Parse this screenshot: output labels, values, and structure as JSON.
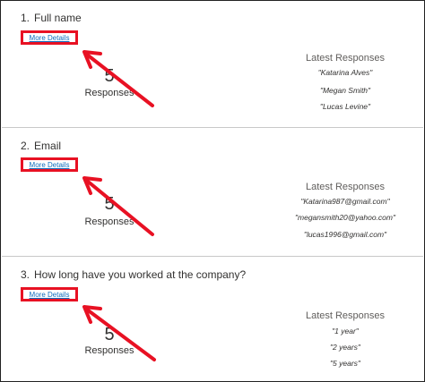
{
  "questions": [
    {
      "number": "1.",
      "title": "Full name",
      "more_details": "More Details",
      "count": "5",
      "count_label": "Responses",
      "latest_title": "Latest Responses",
      "responses": [
        "\"Katarina Alves\"",
        "\"Megan Smith\"",
        "\"Lucas Levine\""
      ]
    },
    {
      "number": "2.",
      "title": "Email",
      "more_details": "More Details",
      "count": "5",
      "count_label": "Responses",
      "latest_title": "Latest Responses",
      "responses": [
        "\"Katarina987@gmail.com\"",
        "\"megansmith20@yahoo.com\"",
        "\"lucas1996@gmail.com\""
      ]
    },
    {
      "number": "3.",
      "title": "How long have you worked at the company?",
      "more_details": "More Details",
      "count": "5",
      "count_label": "Responses",
      "latest_title": "Latest Responses",
      "responses": [
        "\"1 year\"",
        "\"2 years\"",
        "\"5 years\""
      ]
    }
  ],
  "colors": {
    "highlight": "#e81123",
    "link": "#0f6cbd"
  }
}
